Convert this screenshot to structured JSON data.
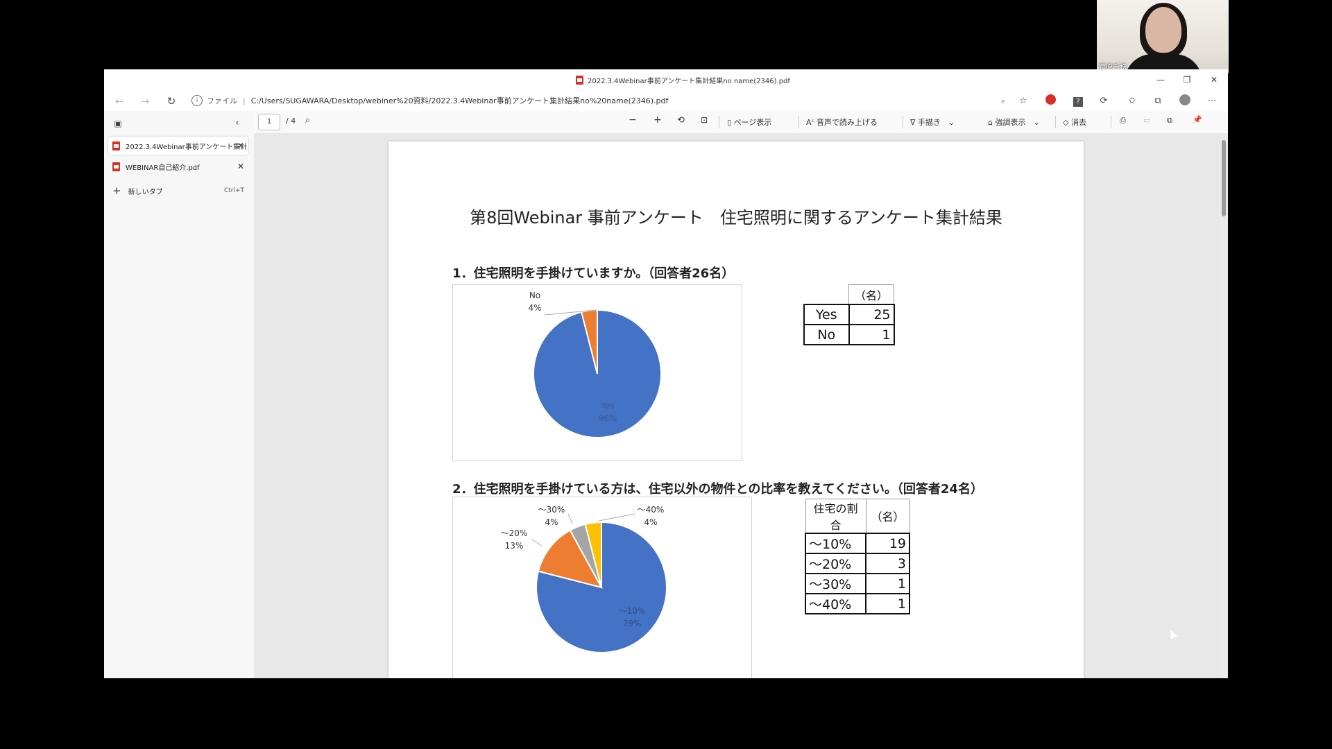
{
  "webcam": {
    "name": "菅原千穂"
  },
  "window": {
    "title": "2022.3.4Webinar事前アンケート集計結果no name(2346).pdf",
    "minimize": "—",
    "restore": "❐",
    "close": "✕"
  },
  "address": {
    "scheme": "ファイル",
    "url": "C:/Users/SUGAWARA/Desktop/webiner%20資料/2022.3.4Webinar事前アンケート集計結果no%20name(2346).pdf"
  },
  "sidebar": {
    "tabs": [
      {
        "label": "2022.3.4Webinar事前アンケート集計"
      },
      {
        "label": "WEBINAR自己紹介.pdf"
      }
    ],
    "new_tab_label": "新しいタブ",
    "new_tab_shortcut": "Ctrl+T"
  },
  "pdf_toolbar": {
    "page": "1",
    "total": "/ 4",
    "page_view": "ページ表示",
    "read_aloud": "音声で読み上げる",
    "draw": "手描き",
    "highlight": "強調表示",
    "erase": "消去"
  },
  "document": {
    "title": "第8回Webinar 事前アンケート　住宅照明に関するアンケート集計結果",
    "q1": {
      "question": "1．住宅照明を手掛けていますか。（回答者26名）",
      "table_header": "（名）",
      "rows": [
        {
          "label": "Yes",
          "value": "25"
        },
        {
          "label": "No",
          "value": "1"
        }
      ]
    },
    "q2": {
      "question": "2．住宅照明を手掛けている方は、住宅以外の物件との比率を教えてください。（回答者24名）",
      "table_header_1": "住宅の割合",
      "table_header_2": "（名）",
      "rows": [
        {
          "label": "～10%",
          "value": "19"
        },
        {
          "label": "～20%",
          "value": "3"
        },
        {
          "label": "～30%",
          "value": "1"
        },
        {
          "label": "～40%",
          "value": "1"
        }
      ]
    }
  },
  "colors": {
    "blue": "#4472c4",
    "orange": "#ed7d31",
    "gray": "#a5a5a5",
    "yellow": "#ffc000"
  },
  "chart_data": [
    {
      "type": "pie",
      "categories": [
        "Yes",
        "No"
      ],
      "values": [
        96,
        4
      ],
      "labels": [
        "Yes\n96%",
        "No\n4%"
      ],
      "colors": [
        "#4472c4",
        "#ed7d31"
      ]
    },
    {
      "type": "pie",
      "categories": [
        "～10%",
        "～20%",
        "～30%",
        "～40%"
      ],
      "values": [
        79,
        13,
        4,
        4
      ],
      "labels": [
        "～10%\n79%",
        "～20%\n13%",
        "～30%\n4%",
        "～40%\n4%"
      ],
      "colors": [
        "#4472c4",
        "#ed7d31",
        "#a5a5a5",
        "#ffc000"
      ]
    }
  ]
}
